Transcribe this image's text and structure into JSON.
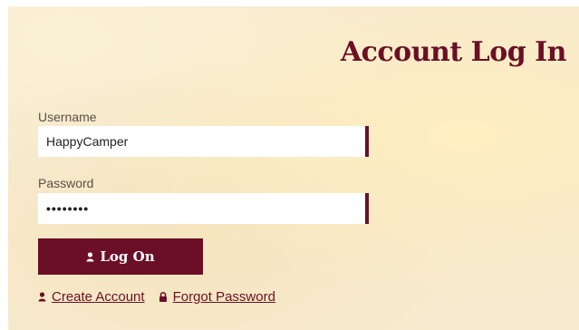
{
  "page": {
    "title": "Account Log In"
  },
  "form": {
    "username_label": "Username",
    "username_value": "HappyCamper",
    "password_label": "Password",
    "password_value": "••••••••",
    "submit_label": "Log On"
  },
  "links": {
    "create_account": "Create Account",
    "forgot_password": "Forgot Password"
  },
  "icons": {
    "submit": "user-icon",
    "create_account": "user-icon",
    "forgot_password": "lock-icon"
  },
  "colors": {
    "brand": "#6b0f26",
    "background": "#f7ebcf"
  }
}
